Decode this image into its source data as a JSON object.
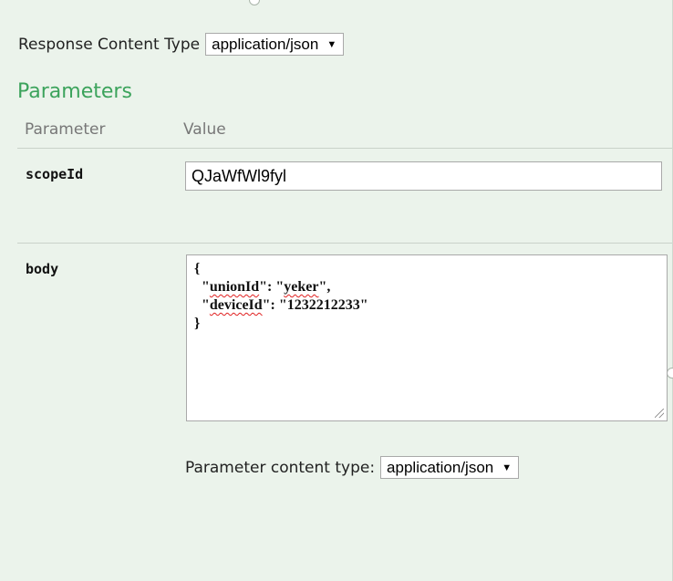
{
  "response": {
    "content_type_label": "Response Content Type",
    "content_type_value": "application/json",
    "dropdown_arrow": "▼"
  },
  "parameters": {
    "title": "Parameters",
    "headers": {
      "parameter": "Parameter",
      "value": "Value"
    },
    "rows": [
      {
        "name": "scopeId",
        "value": "QJaWfWl9fyl"
      },
      {
        "name": "body",
        "lines": [
          "{",
          "  \"unionId\": \"yeker\",",
          "  \"deviceId\": \"1232212233\"",
          "}"
        ],
        "body_parts": {
          "l1_q1": "  \"",
          "l1_key": "unionId",
          "l1_mid": "\": \"",
          "l1_val": "yeker",
          "l1_end": "\",",
          "l2_q1": "  \"",
          "l2_key": "deviceId",
          "l2_mid": "\": \"1232212233\""
        },
        "content_type_label": "Parameter content type:",
        "content_type_value": "application/json"
      }
    ]
  },
  "colors": {
    "accent": "#3ca35c",
    "background": "#ebf3eb"
  }
}
